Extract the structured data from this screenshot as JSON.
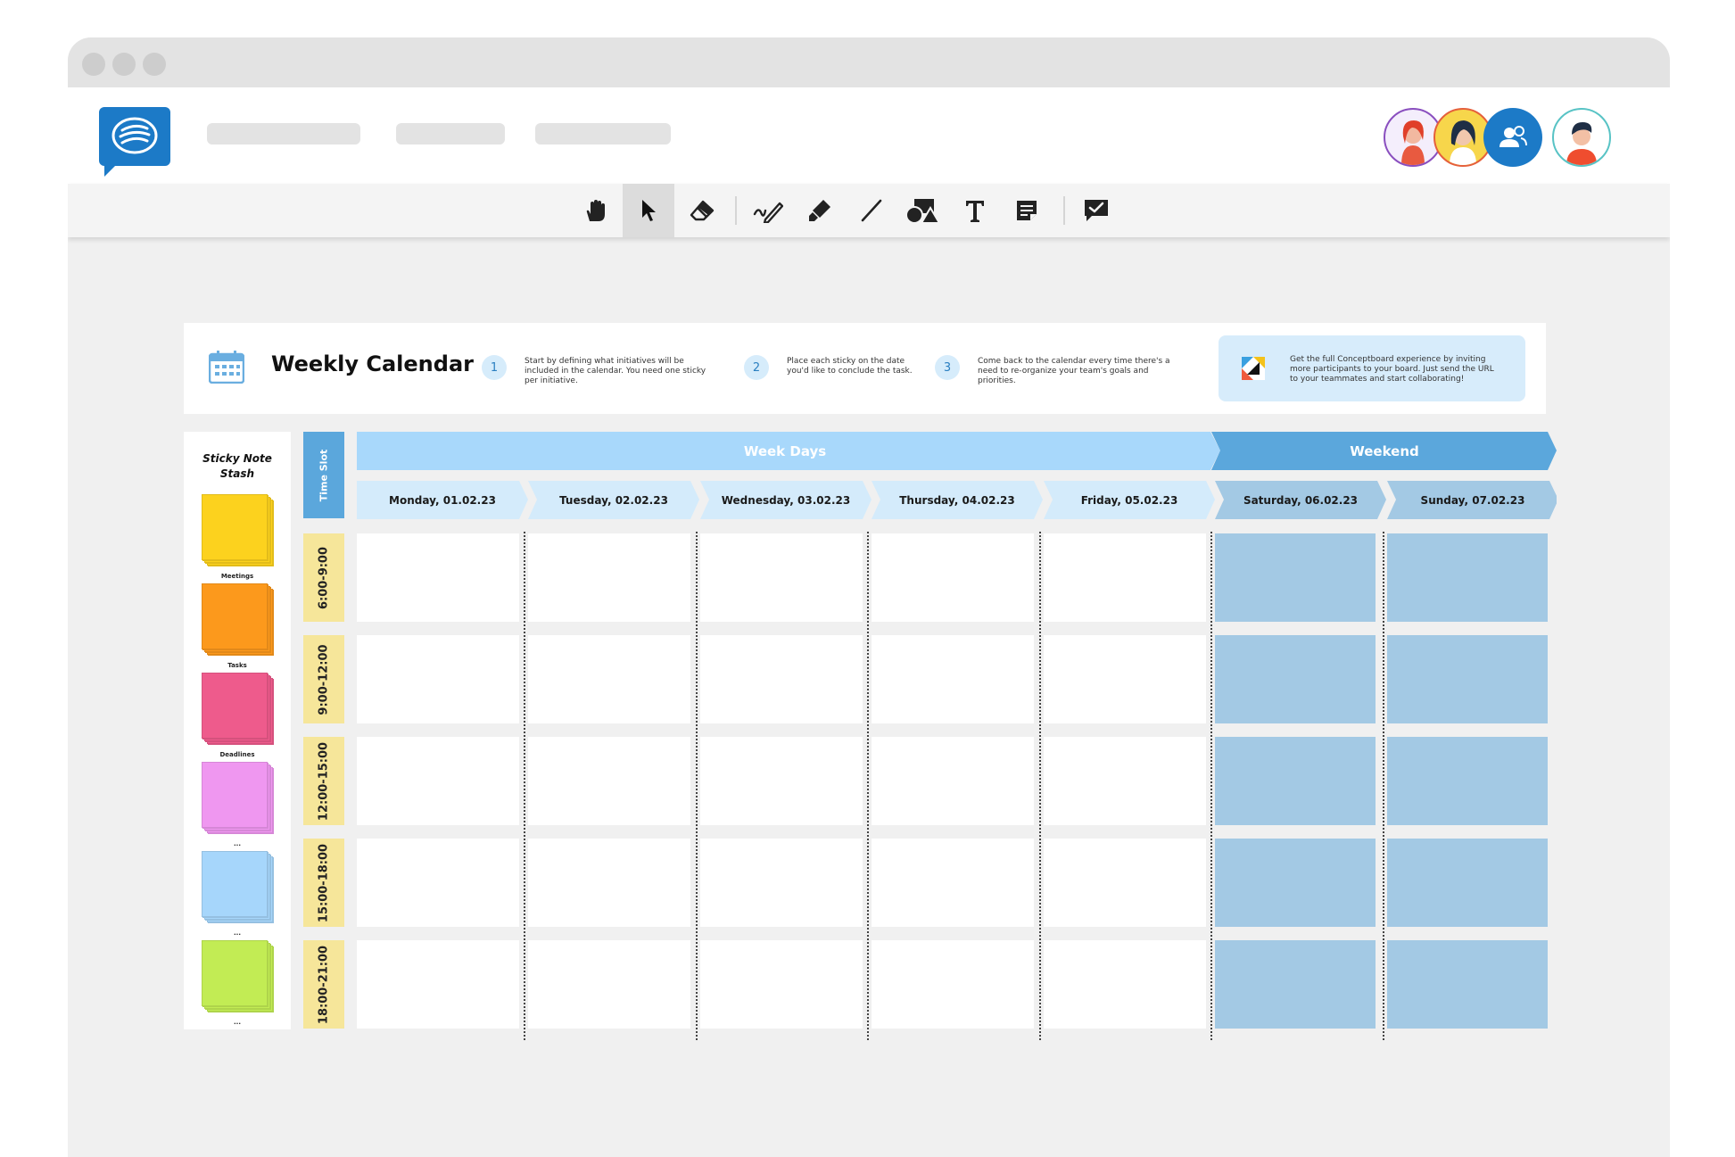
{
  "calendar": {
    "title": "Weekly Calendar",
    "steps": [
      {
        "num": "1",
        "text": "Start by defining what initiatives will be included in the calendar. You need one sticky per initiative."
      },
      {
        "num": "2",
        "text": "Place each sticky on the date you'd like to conclude the task."
      },
      {
        "num": "3",
        "text": "Come back to the calendar every time there's a need to re-organize your team's goals and priorities."
      }
    ],
    "promo_text": "Get the full Conceptboard experience by inviting more participants to your board. Just send the URL to your teammates and start collaborating!",
    "stash_title": "Sticky Note Stash",
    "stash_pads": [
      {
        "label": "Meetings",
        "color": "#fcd21e"
      },
      {
        "label": "Tasks",
        "color": "#fc991c"
      },
      {
        "label": "Deadlines",
        "color": "#ee5b8c"
      },
      {
        "label": "...",
        "color": "#ef97f0"
      },
      {
        "label": "...",
        "color": "#a6d6fb"
      },
      {
        "label": "...",
        "color": "#c2ec54"
      }
    ],
    "time_slot_label": "Time Slot",
    "weekdays_label": "Week Days",
    "weekend_label": "Weekend",
    "days": [
      "Monday, 01.02.23",
      "Tuesday, 02.02.23",
      "Wednesday, 03.02.23",
      "Thursday, 04.02.23",
      "Friday, 05.02.23",
      "Saturday, 06.02.23",
      "Sunday, 07.02.23"
    ],
    "time_slots": [
      "6:00-9:00",
      "9:00-12:00",
      "12:00-15:00",
      "15:00-18:00",
      "18:00-21:00"
    ]
  },
  "toolbar": {
    "tools": [
      "hand-icon",
      "pointer-icon",
      "eraser-icon",
      "pen-icon",
      "highlighter-icon",
      "line-icon",
      "shapes-icon",
      "text-icon",
      "sticky-note-icon",
      "review-icon"
    ],
    "active_tool": "pointer-icon"
  },
  "colors": {
    "brand": "#1c7ac7",
    "weekday_band": "#a8d8fb",
    "weekend_band": "#5ba7dc",
    "weekend_cell": "#a3c9e4",
    "time_slot": "#f6e69a"
  }
}
